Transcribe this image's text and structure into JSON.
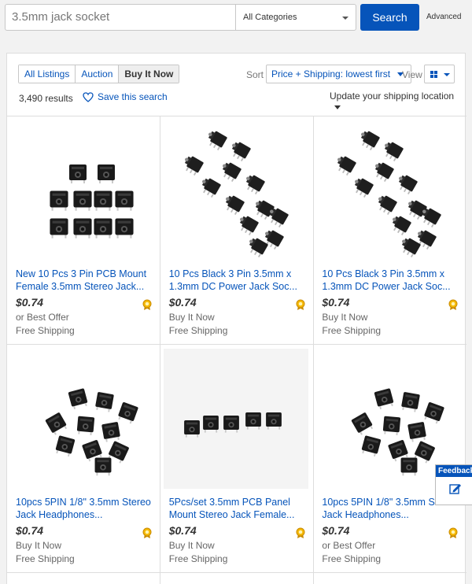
{
  "search": {
    "query": "3.5mm jack socket",
    "category": "All Categories",
    "button_label": "Search",
    "advanced_label": "Advanced"
  },
  "listing_tabs": [
    "All Listings",
    "Auction",
    "Buy It Now"
  ],
  "active_tab": "Buy It Now",
  "results_count": "3,490 results",
  "save_search_label": "Save this search",
  "sort": {
    "label": "Sort",
    "value": "Price + Shipping: lowest first"
  },
  "view_label": "View",
  "shipping_location_label": "Update your shipping location",
  "items": [
    {
      "title": "New 10 Pcs 3 Pin PCB Mount Female 3.5mm Stereo Jack...",
      "price": "$0.74",
      "format": "or Best Offer",
      "shipping": "Free Shipping",
      "image": "jack-grid-10"
    },
    {
      "title": "10 Pcs Black 3 Pin 3.5mm x 1.3mm DC Power Jack Soc...",
      "price": "$0.74",
      "format": "Buy It Now",
      "shipping": "Free Shipping",
      "image": "jack-diagonal"
    },
    {
      "title": "10 Pcs Black 3 Pin 3.5mm x 1.3mm DC Power Jack Soc...",
      "price": "$0.74",
      "format": "Buy It Now",
      "shipping": "Free Shipping",
      "image": "jack-diagonal"
    },
    {
      "title": "10pcs 5PIN 1/8\" 3.5mm Stereo Jack Headphones...",
      "price": "$0.74",
      "format": "Buy It Now",
      "shipping": "Free Shipping",
      "image": "jack-cluster"
    },
    {
      "title": "5Pcs/set 3.5mm PCB Panel Mount Stereo Jack Female...",
      "price": "$0.74",
      "format": "Buy It Now",
      "shipping": "Free Shipping",
      "image": "jack-row-5"
    },
    {
      "title": "10pcs 5PIN 1/8\" 3.5mm Stereo Jack Headphones...",
      "price": "$0.74",
      "format": "or Best Offer",
      "shipping": "Free Shipping",
      "image": "jack-cluster"
    }
  ],
  "feedback_label": "Feedback",
  "colors": {
    "accent": "#0654ba",
    "badge": "#f5b800"
  }
}
